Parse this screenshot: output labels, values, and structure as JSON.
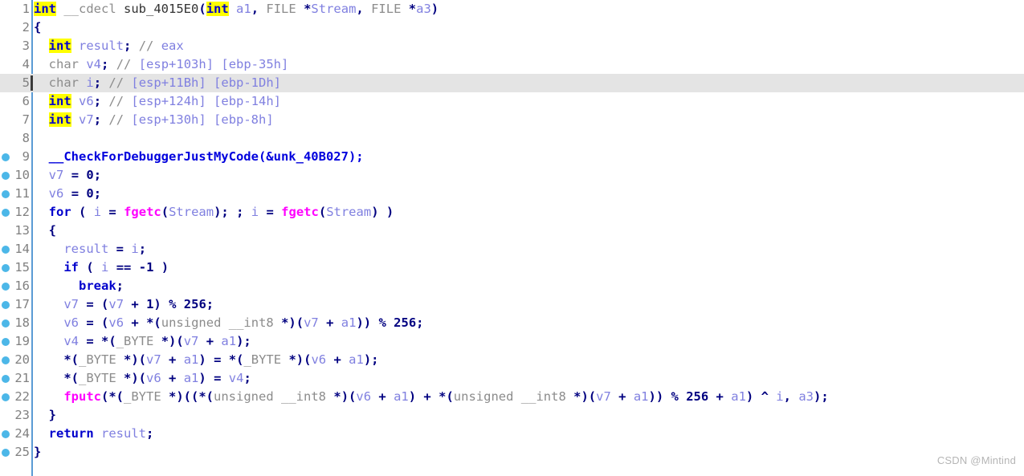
{
  "app": {
    "view": "ida-pseudocode",
    "watermark": "CSDN @Mintind"
  },
  "colors": {
    "keyword": "#0000cc",
    "highlight_bg": "#ffff00",
    "type": "#8c8c8c",
    "call": "#ff00ff",
    "variable": "#8080e0",
    "punctuation": "#000080",
    "comment": "#8c8c8c",
    "comment_value": "#8080e0",
    "gutter_text": "#808080",
    "marker_dot": "#4cb7e8",
    "separator": "#5a9bd5",
    "current_line_bg": "#e4e4e4",
    "background": "#ffffff"
  },
  "lines": [
    {
      "n": "1",
      "dot": false,
      "current": false,
      "text": "int __cdecl sub_4015E0(int a1, FILE *Stream, FILE *a3)"
    },
    {
      "n": "2",
      "dot": false,
      "current": false,
      "text": "{"
    },
    {
      "n": "3",
      "dot": false,
      "current": false,
      "text": "  int result; // eax"
    },
    {
      "n": "4",
      "dot": false,
      "current": false,
      "text": "  char v4; // [esp+103h] [ebp-35h]"
    },
    {
      "n": "5",
      "dot": false,
      "current": true,
      "text": "  char i; // [esp+11Bh] [ebp-1Dh]"
    },
    {
      "n": "6",
      "dot": false,
      "current": false,
      "text": "  int v6; // [esp+124h] [ebp-14h]"
    },
    {
      "n": "7",
      "dot": false,
      "current": false,
      "text": "  int v7; // [esp+130h] [ebp-8h]"
    },
    {
      "n": "8",
      "dot": false,
      "current": false,
      "text": ""
    },
    {
      "n": "9",
      "dot": true,
      "current": false,
      "text": "  __CheckForDebuggerJustMyCode(&unk_40B027);"
    },
    {
      "n": "10",
      "dot": true,
      "current": false,
      "text": "  v7 = 0;"
    },
    {
      "n": "11",
      "dot": true,
      "current": false,
      "text": "  v6 = 0;"
    },
    {
      "n": "12",
      "dot": true,
      "current": false,
      "text": "  for ( i = fgetc(Stream); ; i = fgetc(Stream) )"
    },
    {
      "n": "13",
      "dot": false,
      "current": false,
      "text": "  {"
    },
    {
      "n": "14",
      "dot": true,
      "current": false,
      "text": "    result = i;"
    },
    {
      "n": "15",
      "dot": true,
      "current": false,
      "text": "    if ( i == -1 )"
    },
    {
      "n": "16",
      "dot": true,
      "current": false,
      "text": "      break;"
    },
    {
      "n": "17",
      "dot": true,
      "current": false,
      "text": "    v7 = (v7 + 1) % 256;"
    },
    {
      "n": "18",
      "dot": true,
      "current": false,
      "text": "    v6 = (v6 + *(unsigned __int8 *)(v7 + a1)) % 256;"
    },
    {
      "n": "19",
      "dot": true,
      "current": false,
      "text": "    v4 = *(_BYTE *)(v7 + a1);"
    },
    {
      "n": "20",
      "dot": true,
      "current": false,
      "text": "    *(_BYTE *)(v7 + a1) = *(_BYTE *)(v6 + a1);"
    },
    {
      "n": "21",
      "dot": true,
      "current": false,
      "text": "    *(_BYTE *)(v6 + a1) = v4;"
    },
    {
      "n": "22",
      "dot": true,
      "current": false,
      "text": "    fputc(*(_BYTE *)((*(unsigned __int8 *)(v6 + a1) + *(unsigned __int8 *)(v7 + a1)) % 256 + a1) ^ i, a3);"
    },
    {
      "n": "23",
      "dot": false,
      "current": false,
      "text": "  }"
    },
    {
      "n": "24",
      "dot": true,
      "current": false,
      "text": "  return result;"
    },
    {
      "n": "25",
      "dot": true,
      "current": false,
      "text": "}"
    }
  ],
  "tokens": {
    "keywords_highlighted": [
      "int"
    ],
    "keywords": [
      "for",
      "if",
      "break",
      "return"
    ],
    "types": [
      "char",
      "unsigned",
      "__int8",
      "_BYTE",
      "__cdecl",
      "FILE"
    ],
    "calls": [
      "fgetc",
      "fputc"
    ],
    "variables": [
      "a1",
      "a3",
      "i",
      "v4",
      "v6",
      "v7",
      "result",
      "Stream",
      "eax"
    ],
    "function_name": "sub_4015E0",
    "data_ref": "unk_40B027",
    "api": "__CheckForDebuggerJustMyCode"
  }
}
